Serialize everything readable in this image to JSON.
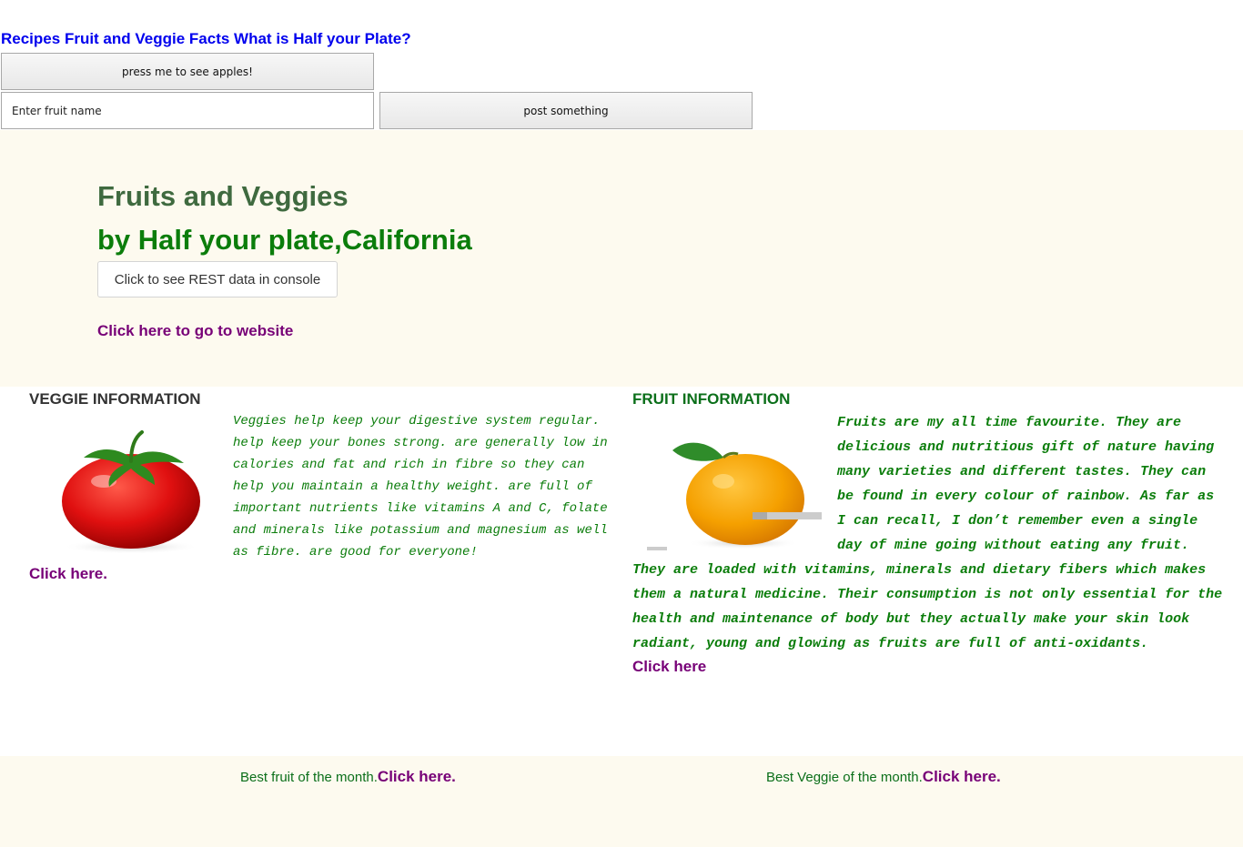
{
  "nav": {
    "recipes": "Recipes",
    "facts": "Fruit and Veggie Facts",
    "half_plate": "What is Half your Plate?"
  },
  "controls": {
    "apples_button": "press me to see apples!",
    "fruit_input_placeholder": "Enter fruit name",
    "post_button": "post something"
  },
  "hero": {
    "title": "Fruits and Veggies",
    "subtitle": "by Half your plate,California",
    "rest_button": "Click to see REST data in console",
    "website_link": "Click here to go to website"
  },
  "veggie": {
    "heading": "VEGGIE INFORMATION",
    "text": "Veggies help keep your digestive system regular. help keep your bones strong. are generally low in calories and fat and rich in fibre so they can help you maintain a healthy weight. are full of important nutrients like vitamins A and C, folate and minerals like potassium and magnesium as well as fibre. are good for everyone!",
    "link": "Click here.",
    "image_icon": "tomato-image"
  },
  "fruit": {
    "heading": "FRUIT INFORMATION",
    "text": "Fruits are my all time favourite. They are delicious and nutritious gift of nature having many varieties and different tastes. They can be found in every colour of rainbow. As far as I can recall, I don’t remember even a single day of mine going without eating any fruit. They are loaded with vitamins, minerals and dietary fibers which makes them a natural medicine. Their consumption is not only essential for the health and maintenance of body but they actually make your skin look radiant, young and glowing as fruits are full of anti-oxidants.",
    "link": "Click here",
    "image_icon": "orange-image"
  },
  "footer": {
    "best_fruit_text": "Best fruit of the month.",
    "best_fruit_link": "Click here.",
    "best_veggie_text": "Best Veggie of the month.",
    "best_veggie_link": "Click here."
  },
  "colors": {
    "nav_link": "#0000ee",
    "visited_link": "#770077",
    "hero_title": "#3f6a3f",
    "hero_subtitle": "#0b7d0b",
    "band_background": "#fdfaef",
    "body_text_green": "#0b7d0b"
  }
}
